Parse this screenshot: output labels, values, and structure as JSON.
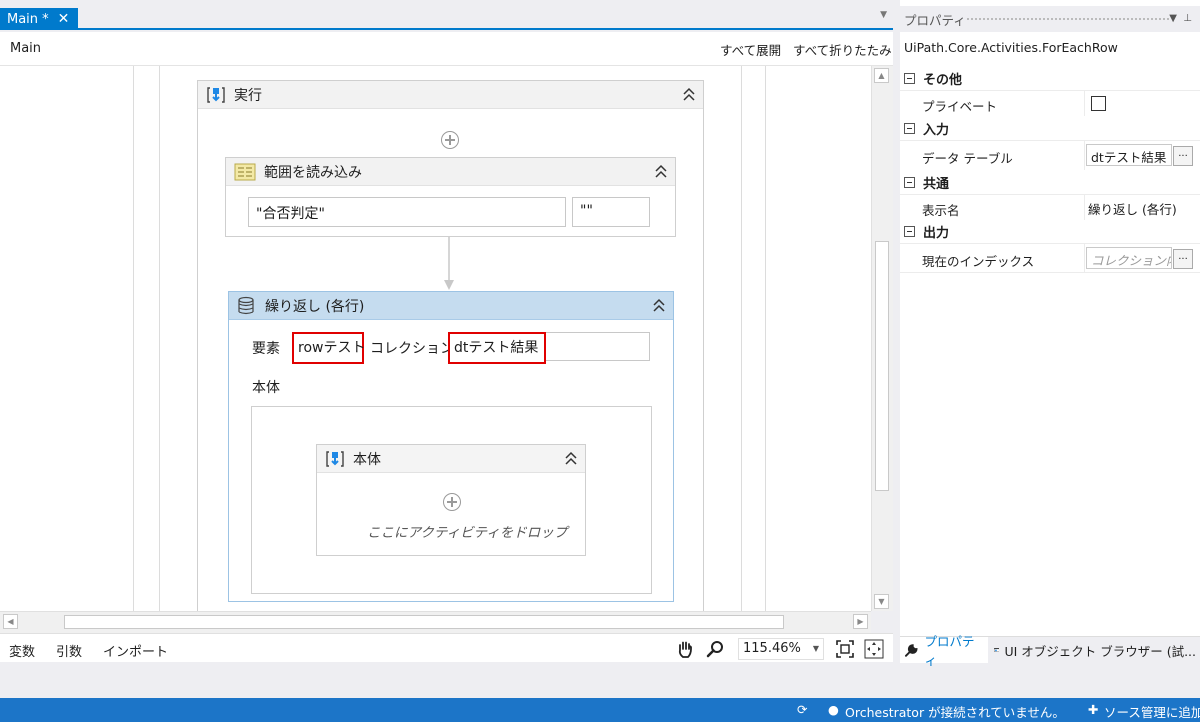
{
  "designer": {
    "tab_label": "Main *",
    "tab_close": "✕",
    "breadcrumb": "Main",
    "expand_all": "すべて展開",
    "collapse_all": "すべて折りたたみ"
  },
  "workflow": {
    "sequence_title": "実行",
    "read_range": {
      "title": "範囲を読み込み",
      "sheet_value": "\"合否判定\"",
      "range_value": "\"\""
    },
    "for_each_row": {
      "title": "繰り返し (各行)",
      "item_label": "要素",
      "item_value": "rowテスト",
      "collection_label": "コレクション",
      "collection_value": "dtテスト結果",
      "body_label": "本体",
      "inner_title": "本体",
      "drop_hint": "ここにアクティビティをドロップ"
    }
  },
  "bottom_bar": {
    "variables": "変数",
    "arguments": "引数",
    "imports": "インポート",
    "zoom": "115.46%"
  },
  "properties": {
    "panel_title": "プロパティ",
    "activity_type": "UiPath.Core.Activities.ForEachRow",
    "categories": {
      "misc": "その他",
      "input": "入力",
      "common": "共通",
      "output": "出力"
    },
    "rows": {
      "private": "プライベート",
      "datatable_name": "データ テーブル",
      "datatable_value": "dtテスト結果",
      "display_name": "表示名",
      "display_value": "繰り返し (各行)",
      "index_name": "現在のインデックス",
      "index_placeholder": "コレクション内"
    },
    "tabs": {
      "properties": "プロパティ",
      "ui_browser": "UI オブジェクト ブラウザー (試..."
    }
  },
  "statusbar": {
    "orchestrator": "Orchestrator が接続されていません。",
    "source_control": "ソース管理に追加"
  },
  "colors": {
    "accent": "#007acc",
    "statusbar": "#1c75c8",
    "highlight": "#e00000",
    "selected_activity": "#c5dcef"
  }
}
